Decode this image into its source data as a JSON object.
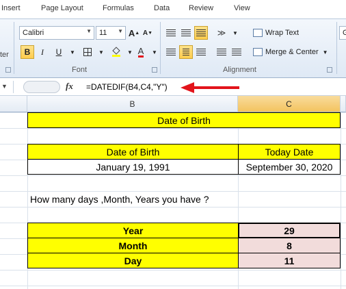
{
  "menu_tabs": [
    "Insert",
    "Page Layout",
    "Formulas",
    "Data",
    "Review",
    "View"
  ],
  "ribbon": {
    "font_name": "Calibri",
    "font_size": "11",
    "grow_font": "A",
    "shrink_font": "A",
    "bold": "B",
    "italic": "I",
    "underline": "U",
    "font_color_glyph": "A",
    "font_group": "Font",
    "alignment_group": "Alignment",
    "wrap_text": "Wrap Text",
    "merge_center": "Merge & Center",
    "left_cut": "ter",
    "right_cut": "G"
  },
  "formula_bar": {
    "fx": "fx",
    "formula": "=DATEDIF(B4,C4,\"Y\")"
  },
  "columns": {
    "b": "B",
    "c": "C"
  },
  "sheet": {
    "title": "Date of Birth",
    "dob_header": "Date of Birth",
    "today_header": "Today Date",
    "dob_value": "January 19, 1991",
    "today_value": "September 30, 2020",
    "question": "How many days ,Month, Years you have ?",
    "results": [
      {
        "label": "Year",
        "value": "29"
      },
      {
        "label": "Month",
        "value": "8"
      },
      {
        "label": "Day",
        "value": "11"
      }
    ]
  },
  "colors": {
    "highlight": "#ffff00",
    "result_fill": "#f2dcdb",
    "arrow": "#e2141b"
  }
}
